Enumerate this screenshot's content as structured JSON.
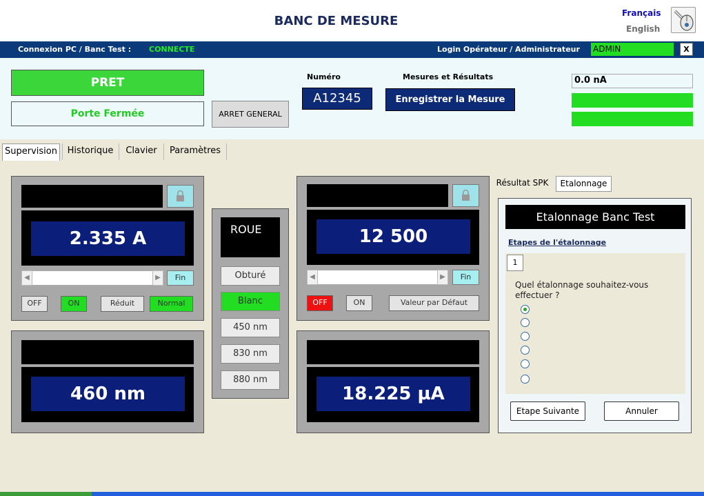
{
  "header": {
    "title": "BANC DE MESURE",
    "languages": [
      "Français",
      "English"
    ],
    "icon": "mouse-icon"
  },
  "statusbar": {
    "connection_label": "Connexion PC / Banc Test :",
    "connection_value": "CONNECTE",
    "login_label": "Login Opérateur / Administrateur",
    "login_value": "ADMIN",
    "close_label": "X"
  },
  "top": {
    "state": "PRET",
    "door": "Porte Fermée",
    "emergency_stop": "ARRET GENERAL",
    "numero_label": "Numéro",
    "numero_value": "A12345",
    "mesures_label": "Mesures et Résultats",
    "save_label": "Enregistrer la Mesure",
    "current_reading": "0.0 nA"
  },
  "tabs": [
    "Supervision",
    "Historique",
    "Clavier",
    "Paramètres"
  ],
  "active_tab": "Supervision",
  "current_panel": {
    "value": "2.335 A",
    "fin": "Fin",
    "buttons": [
      "OFF",
      "ON",
      "Réduit",
      "Normal"
    ]
  },
  "wavelength_panel": {
    "value": "460 nm"
  },
  "wheel_panel": {
    "title": "ROUE",
    "options": [
      "Obturé",
      "Blanc",
      "450 nm",
      "830 nm",
      "880 nm"
    ],
    "selected": "Blanc"
  },
  "speed_panel": {
    "value": "12 500",
    "fin": "Fin",
    "buttons": [
      "OFF",
      "ON",
      "Valeur par Défaut"
    ]
  },
  "measure_panel": {
    "value": "18.225 µA"
  },
  "right_tabs": [
    "Résultat SPK",
    "Etalonnage"
  ],
  "active_right_tab": "Etalonnage",
  "calibration": {
    "title": "Etalonnage Banc Test",
    "steps_label": "Etapes de l'étalonnage",
    "step_number": "1",
    "question": "Quel étalonnage souhaitez-vous effectuer ?",
    "radio_count": 6,
    "next_label": "Etape Suivante",
    "cancel_label": "Annuler"
  },
  "colors": {
    "header_blue": "#0a3a7a",
    "display_blue": "#0b1f7a",
    "status_green": "#22dd22",
    "alert_red": "#ee1111",
    "panel_gray": "#a8a8a8"
  }
}
